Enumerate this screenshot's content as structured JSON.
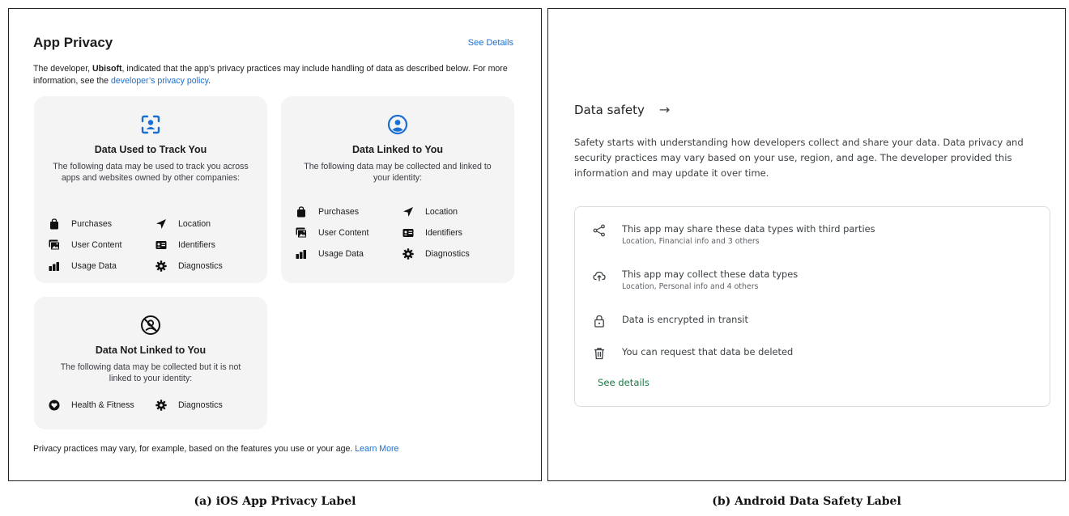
{
  "ios": {
    "title": "App Privacy",
    "see_details": "See Details",
    "desc_prefix": "The developer, ",
    "developer": "Ubisoft",
    "desc_middle": ", indicated that the app’s privacy practices may include handling of data as described below. For more information, see the ",
    "policy_link": "developer’s privacy policy",
    "desc_suffix": ".",
    "cards": [
      {
        "title": "Data Used to Track You",
        "icon": "track-face-icon",
        "desc": "The following data may be used to track you across apps and websites owned by other companies:",
        "items": [
          {
            "label": "Purchases",
            "icon": "bag-icon"
          },
          {
            "label": "Location",
            "icon": "location-arrow-icon"
          },
          {
            "label": "User Content",
            "icon": "photo-icon"
          },
          {
            "label": "Identifiers",
            "icon": "id-card-icon"
          },
          {
            "label": "Usage Data",
            "icon": "bar-chart-icon"
          },
          {
            "label": "Diagnostics",
            "icon": "gear-icon"
          }
        ]
      },
      {
        "title": "Data Linked to You",
        "icon": "person-circle-icon",
        "desc": "The following data may be collected and linked to your identity:",
        "items": [
          {
            "label": "Purchases",
            "icon": "bag-icon"
          },
          {
            "label": "Location",
            "icon": "location-arrow-icon"
          },
          {
            "label": "User Content",
            "icon": "photo-icon"
          },
          {
            "label": "Identifiers",
            "icon": "id-card-icon"
          },
          {
            "label": "Usage Data",
            "icon": "bar-chart-icon"
          },
          {
            "label": "Diagnostics",
            "icon": "gear-icon"
          }
        ]
      },
      {
        "title": "Data Not Linked to You",
        "icon": "person-slash-icon",
        "desc": "The following data may be collected but it is not linked to your identity:",
        "items": [
          {
            "label": "Health & Fitness",
            "icon": "heart-icon"
          },
          {
            "label": "Diagnostics",
            "icon": "gear-icon"
          }
        ]
      }
    ],
    "footer_text": "Privacy practices may vary, for example, based on the features you use or your age. ",
    "footer_link": "Learn More"
  },
  "android": {
    "title": "Data safety",
    "arrow": "→",
    "desc": "Safety starts with understanding how developers collect and share your data. Data privacy and security practices may vary based on your use, region, and age. The developer provided this information and may update it over time.",
    "rows": [
      {
        "text": "This app may share these data types with third parties",
        "sub": "Location, Financial info and 3 others",
        "icon": "share-icon"
      },
      {
        "text": "This app may collect these data types",
        "sub": "Location, Personal info and 4 others",
        "icon": "cloud-upload-icon"
      },
      {
        "text": "Data is encrypted in transit",
        "sub": "",
        "icon": "lock-icon"
      },
      {
        "text": "You can request that data be deleted",
        "sub": "",
        "icon": "trash-icon"
      }
    ],
    "see_details": "See details"
  },
  "captions": {
    "a": "(a) iOS App Privacy Label",
    "b": "(b) Android Data Safety Label"
  },
  "colors": {
    "ios_link": "#1a6fd1",
    "android_link": "#1a7a45",
    "card_bg": "#f4f4f5",
    "ios_icon_blue": "#1a6fd1"
  }
}
